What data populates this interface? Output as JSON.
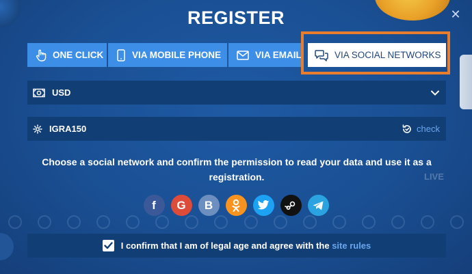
{
  "modal": {
    "title": "REGISTER",
    "close_icon": "close-icon"
  },
  "tabs": [
    {
      "label": "ONE CLICK",
      "icon": "hand-pointer-icon",
      "active": false
    },
    {
      "label": "VIA MOBILE PHONE",
      "icon": "mobile-phone-icon",
      "active": false
    },
    {
      "label": "VIA EMAIL",
      "icon": "envelope-icon",
      "active": false
    },
    {
      "label": "VIA SOCIAL NETWORKS",
      "icon": "chat-bubbles-icon",
      "active": true
    }
  ],
  "currency": {
    "value": "USD",
    "icon": "cash-icon",
    "dropdown_icon": "chevron-down-icon"
  },
  "promo": {
    "value": "IGRA150",
    "icon": "gear-icon",
    "check_label": "check",
    "check_icon": "refresh-icon"
  },
  "description": "Choose a social network and confirm the permission to read your data and use it as a registration.",
  "socials": [
    {
      "name": "facebook",
      "glyph": "f",
      "color": "#3b5998"
    },
    {
      "name": "google",
      "glyph": "G",
      "color": "#dd4b39"
    },
    {
      "name": "vk",
      "glyph": "B",
      "color": "#6d8fbf"
    },
    {
      "name": "odnoklassniki",
      "glyph": "ok",
      "color": "#f7931e"
    },
    {
      "name": "twitter",
      "glyph": "t",
      "color": "#1da1f2"
    },
    {
      "name": "steam",
      "glyph": "steam",
      "color": "#111111"
    },
    {
      "name": "telegram",
      "glyph": "tg",
      "color": "#2aa3e0"
    }
  ],
  "confirm": {
    "text": "I confirm that I am of legal age and agree with the",
    "link": "site rules",
    "checked": true
  },
  "colors": {
    "tab_bg": "#3d8ee6",
    "field_bg": "#123e76",
    "highlight": "#e87d2e",
    "link": "#6aa7ef"
  }
}
